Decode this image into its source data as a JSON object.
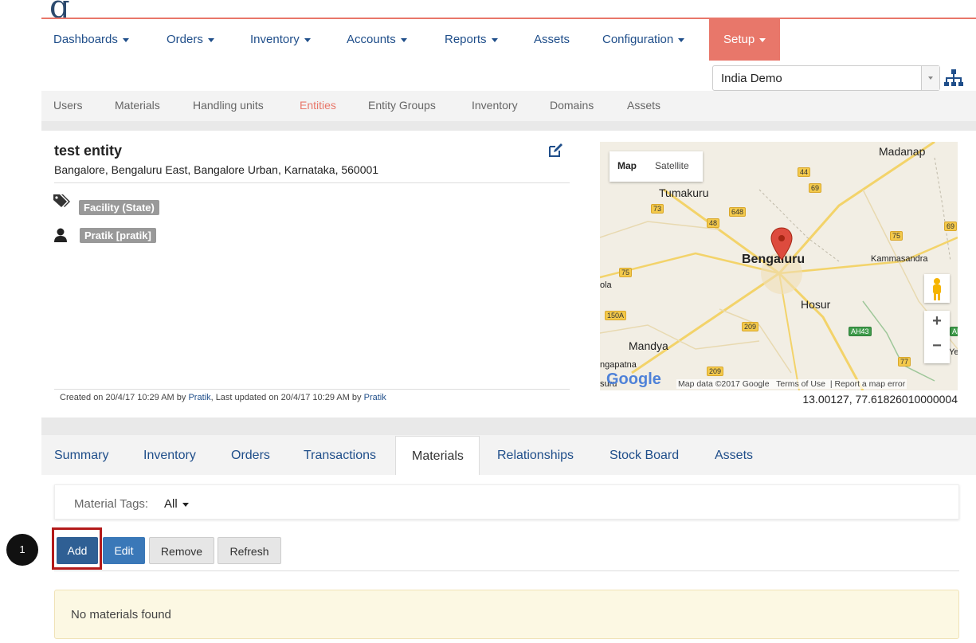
{
  "main_nav": [
    {
      "label": "Dashboards",
      "dropdown": true
    },
    {
      "label": "Orders",
      "dropdown": true
    },
    {
      "label": "Inventory",
      "dropdown": true
    },
    {
      "label": "Accounts",
      "dropdown": true
    },
    {
      "label": "Reports",
      "dropdown": true
    },
    {
      "label": "Assets",
      "dropdown": false
    },
    {
      "label": "Configuration",
      "dropdown": true
    },
    {
      "label": "Setup",
      "dropdown": true,
      "active": true
    }
  ],
  "domain_select": {
    "value": "India Demo"
  },
  "sub_nav": [
    "Users",
    "Materials",
    "Handling units",
    "Entities",
    "Entity Groups",
    "Inventory",
    "Domains",
    "Assets"
  ],
  "sub_nav_active": "Entities",
  "entity": {
    "name": "test entity",
    "address": "Bangalore, Bengaluru East, Bangalore Urban, Karnataka, 560001",
    "tag": "Facility (State)",
    "user": "Pratik [pratik]",
    "meta": {
      "created_prefix": "Created on 20/4/17 10:29 AM by ",
      "created_by": "Pratik",
      "updated_prefix": ", Last updated on 20/4/17 10:29 AM by ",
      "updated_by": "Pratik"
    }
  },
  "map": {
    "toggle_map": "Map",
    "toggle_satellite": "Satellite",
    "labels": {
      "madanapalle": "Madanap",
      "tumakuru": "Tumakuru",
      "bengaluru": "Bengaluru",
      "kammasandra": "Kammasandra",
      "hosur": "Hosur",
      "mandya": "Mandya",
      "ola": "ola",
      "srirangapatna": "ngapatna",
      "suru": "suru",
      "ye": "Ye"
    },
    "shields": [
      "44",
      "69",
      "73",
      "648",
      "48",
      "75",
      "69",
      "75",
      "150A",
      "209",
      "AH43",
      "77",
      "209",
      "AH"
    ],
    "zoom_in": "+",
    "zoom_out": "−",
    "google": "Google",
    "attribution": "Map data ©2017 Google",
    "terms": "Terms of Use",
    "report": "Report a map error",
    "coordinates": "13.00127, 77.61826010000004"
  },
  "tabs": [
    "Summary",
    "Inventory",
    "Orders",
    "Transactions",
    "Materials",
    "Relationships",
    "Stock Board",
    "Assets"
  ],
  "active_tab": "Materials",
  "filter": {
    "label": "Material Tags:",
    "value": "All"
  },
  "buttons": {
    "add": "Add",
    "edit": "Edit",
    "remove": "Remove",
    "refresh": "Refresh"
  },
  "step_badge": "1",
  "empty_message": "No materials found",
  "colors": {
    "accent": "#e8776a",
    "link": "#1f4e8a",
    "add_button": "#2f5f94",
    "edit_button": "#3a78b8"
  }
}
